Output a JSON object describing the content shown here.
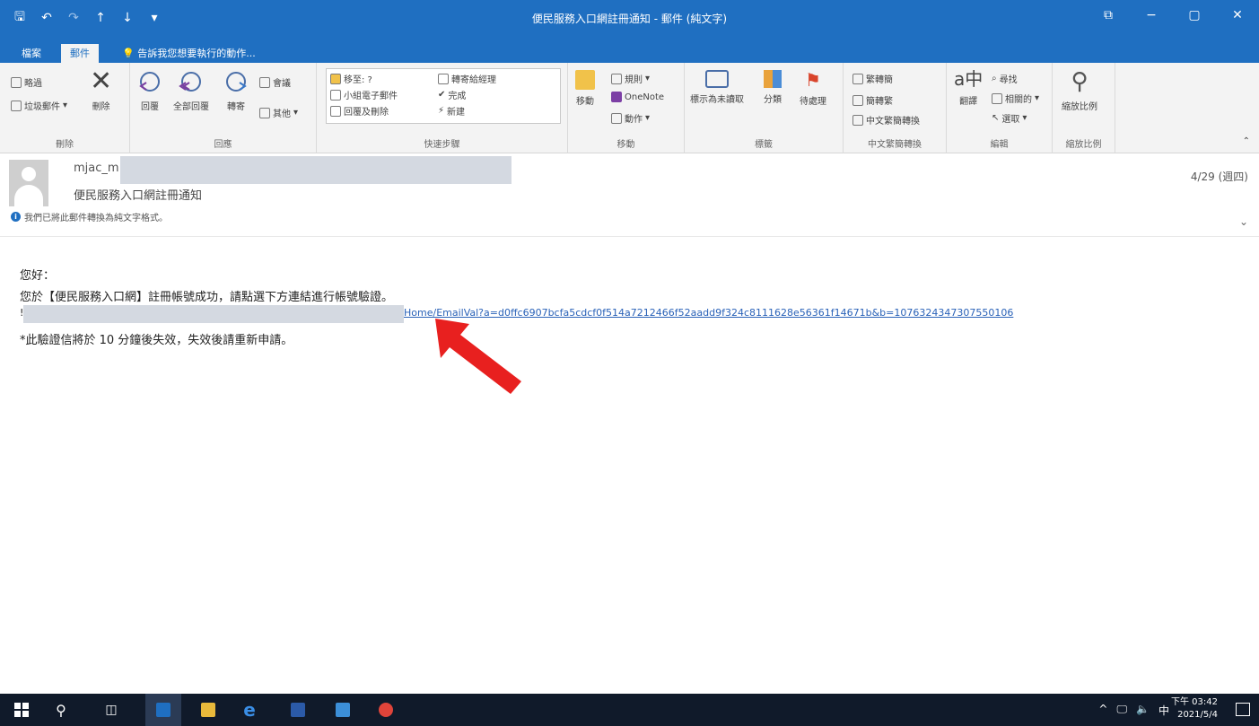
{
  "window": {
    "title": "便民服務入口網註冊通知 - 郵件 (純文字)",
    "qat_icons": [
      "save-icon",
      "undo-icon",
      "redo-icon",
      "up-icon",
      "down-icon",
      "customize-icon"
    ],
    "controls": [
      "⧉",
      "−",
      "▢",
      "✕"
    ]
  },
  "tabs": [
    {
      "label": "檔案"
    },
    {
      "label": "郵件"
    }
  ],
  "tell_me": "告訴我您想要執行的動作...",
  "ribbon": {
    "delete_group": {
      "ignore": "略過",
      "junk": "垃圾郵件",
      "delete": "刪除",
      "label": "刪除"
    },
    "respond_group": {
      "reply": "回覆",
      "reply_all": "全部回覆",
      "forward": "轉寄",
      "meeting": "會議",
      "more": "其他",
      "label": "回應"
    },
    "quick_steps_group": {
      "items": [
        "移至: ?",
        "小組電子郵件",
        "回覆及刪除",
        "轉寄給經理",
        "完成",
        "新建"
      ],
      "label": "快速步驟"
    },
    "move_group": {
      "move": "移動",
      "rules": "規則",
      "onenote": "OneNote",
      "actions": "動作",
      "label": "移動"
    },
    "tags_group": {
      "mark_unread": "標示為未讀取",
      "categorize": "分類",
      "follow_up": "待處理",
      "label": "標籤"
    },
    "chinese_group": {
      "trad_to_simp": "繁轉簡",
      "simp_to_trad": "簡轉繁",
      "conversion": "中文繁簡轉換",
      "label": "中文繁簡轉換"
    },
    "editing_group": {
      "translate": "翻譯",
      "find": "尋找",
      "related": "相關的",
      "select": "選取",
      "label": "編輯"
    },
    "zoom_group": {
      "zoom": "縮放比例",
      "label": "縮放比例"
    }
  },
  "message": {
    "sender": "mjac_m",
    "subject": "便民服務入口網註冊通知",
    "date": "4/29 (週四)",
    "info": "我們已將此郵件轉換為純文字格式。",
    "body": {
      "greeting": "您好：",
      "line1": "您於【便民服務入口網】註冊帳號成功，請點選下方連結進行帳號驗證。",
      "link_prefix": "!",
      "link": "Home/EmailVal?a=d0ffc6907bcfa5cdcf0f514a7212466f52aadd9f324c8111628e56361f14671b&b=1076324347307550106",
      "line3": "*此驗證信將於 10 分鐘後失效，失效後請重新申請。"
    }
  },
  "taskbar": {
    "tray": [
      "^",
      "🖵",
      "🔈",
      "中"
    ],
    "time": "下午 03:42",
    "date": "2021/5/4"
  }
}
